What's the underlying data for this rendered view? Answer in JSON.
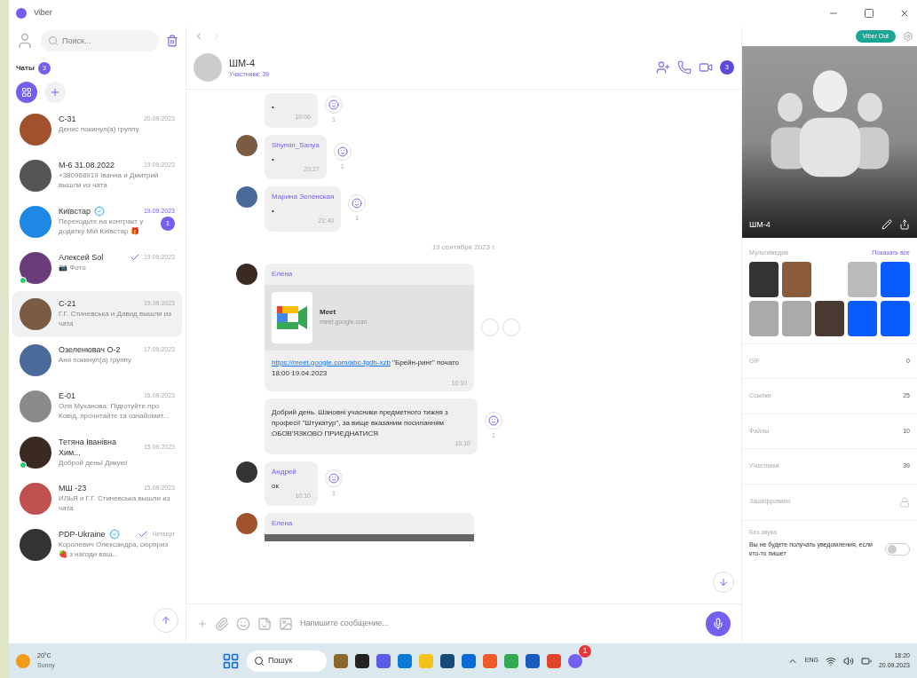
{
  "window": {
    "title": "Viber"
  },
  "sidebar": {
    "search": {
      "placeholder": "Поиск..."
    },
    "heading": "Чаты",
    "count": "3",
    "chats": [
      {
        "name": "С-31",
        "date": "20.09.2023",
        "preview": "Денис покинул(а) группу",
        "verified": false,
        "online": false,
        "selected": false,
        "read": false
      },
      {
        "name": "М-6 31.08.2022",
        "date": "19.09.2023",
        "preview": "+380968919 Іванна и Дмитрий вышли из чата",
        "verified": false,
        "online": false,
        "selected": false,
        "read": false
      },
      {
        "name": "Київстар",
        "date": "19.09.2023",
        "preview": "Переходьте на контракт у додатку Мій Київстар 🎁",
        "verified": true,
        "online": false,
        "selected": false,
        "read": false,
        "unread": "1"
      },
      {
        "name": "Алексей Sol",
        "date": "19.09.2023",
        "preview": "📷 Фото",
        "verified": false,
        "online": true,
        "selected": false,
        "read": true
      },
      {
        "name": "С-21",
        "date": "19.09.2023",
        "preview": "Г.Г. Стиневська и Давид вышли из чата",
        "verified": false,
        "online": false,
        "selected": true,
        "read": false
      },
      {
        "name": "Озеленювач О-2",
        "date": "17.09.2023",
        "preview": "Аня покинул(а) группу",
        "verified": false,
        "online": false,
        "selected": false,
        "read": false
      },
      {
        "name": "Е-01",
        "date": "16.09.2023",
        "preview": "Оля Муханова: Підготуйте про Ковід, прочитайте та ознайомит...",
        "verified": false,
        "online": false,
        "selected": false,
        "read": false
      },
      {
        "name": "Тетяна Іванівна Хим...",
        "date": "15.09.2023",
        "preview": "Доброй день! Дякую!",
        "verified": false,
        "online": true,
        "selected": false,
        "read": false
      },
      {
        "name": "МШ -23",
        "date": "15.09.2023",
        "preview": "ИЛЬЯ и Г.Г. Стиневська вышли из чата",
        "verified": false,
        "online": false,
        "selected": false,
        "read": false
      },
      {
        "name": "PDP-Ukraine",
        "date": "Четверг",
        "preview": "Королевич Олександра, сюрприз 🍓 з нагоди ваш...",
        "verified": true,
        "online": false,
        "selected": false,
        "read": true
      }
    ]
  },
  "chat": {
    "title": "ШМ-4",
    "subtitle": "Участники: 39",
    "badge": "3",
    "messages": [
      {
        "kind": "text",
        "text": "•",
        "time": "10:06",
        "reactions": "1"
      },
      {
        "kind": "text",
        "sender": "Shymin_Sanya",
        "text": "•",
        "time": "20:27",
        "reactions": "1"
      },
      {
        "kind": "text",
        "sender": "Марина Зеленская",
        "text": "•",
        "time": "22:40",
        "reactions": "1"
      },
      {
        "kind": "date",
        "text": "19 сентября 2023 г."
      },
      {
        "kind": "link",
        "sender": "Елена",
        "title": "Meet",
        "site": "meet.google.com",
        "url": "https://meet.google.com/abc-fgdh-xzb",
        "text": " \"Брейн-ринг\" почато 18:00 19.04.2023",
        "time": "10:10"
      },
      {
        "kind": "text",
        "text": "Добрий день. Шановні учасники предметного тижня з професії \"Штукатур\", за вище вказаним посиланням ОБОВ'ЯЗКОВО ПРИЄДНАТИСЯ",
        "time": "10:10",
        "reactions": "1"
      },
      {
        "kind": "text",
        "sender": "Андрей",
        "text": "ок",
        "time": "10:10",
        "reactions": "1"
      },
      {
        "kind": "photo",
        "sender": "Елена"
      }
    ],
    "input": {
      "placeholder": "Напишите сообщение..."
    }
  },
  "info": {
    "viber_out": "Viber Out",
    "name": "ШМ-4",
    "media_label": "Мультимедиа",
    "show_all": "Показать все",
    "rows": [
      {
        "label": "GIF",
        "value": "0"
      },
      {
        "label": "Ссылки",
        "value": "25"
      },
      {
        "label": "Файлы",
        "value": "10"
      },
      {
        "label": "Участники",
        "value": "39"
      },
      {
        "label": "Зашифровано"
      }
    ],
    "mute": {
      "title": "Без звука",
      "text": "Вы не будете получать уведомления, если кто-то пишет",
      "on": false
    }
  },
  "taskbar": {
    "weather": "20°C",
    "weather_text": "Sunny",
    "search": "Пошук",
    "lang": "ENG",
    "time": "18:20",
    "date": "20.09.2023",
    "viber_badge": "1"
  }
}
